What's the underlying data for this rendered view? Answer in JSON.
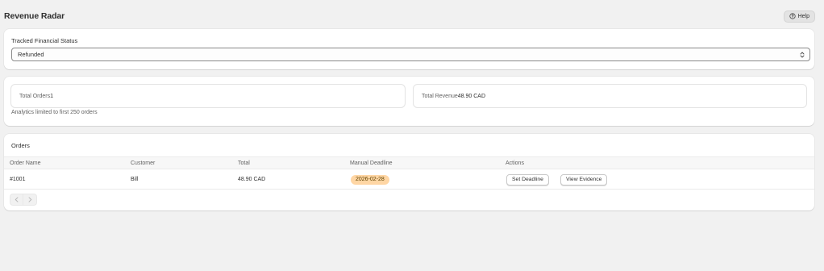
{
  "app": {
    "title": "Revenue Radar"
  },
  "header": {
    "help_label": "Help"
  },
  "status_filter": {
    "label": "Tracked Financial Status",
    "selected": "Refunded"
  },
  "stats": {
    "total_orders_label": "Total Orders",
    "total_orders_value": "1",
    "total_revenue_label": "Total Revenue",
    "total_revenue_value": "48.90 CAD",
    "note": "Analytics limited to first 250 orders"
  },
  "orders": {
    "title": "Orders",
    "columns": [
      "Order Name",
      "Customer",
      "Total",
      "Manual Deadline",
      "Actions"
    ],
    "rows": [
      {
        "order_name": "#1001",
        "customer": "Bill",
        "total": "48.90 CAD",
        "deadline": "2026-02-28",
        "actions": [
          "Set Deadline",
          "View Evidence"
        ]
      }
    ]
  },
  "icons": {
    "help": "question-circle-icon",
    "select": "select-chevron-icon",
    "prev": "chevron-left-icon",
    "next": "chevron-right-icon"
  },
  "colors": {
    "background": "#f1f1f1",
    "card": "#ffffff",
    "badge_bg": "#ffd6a4",
    "badge_text": "#5e4200"
  }
}
